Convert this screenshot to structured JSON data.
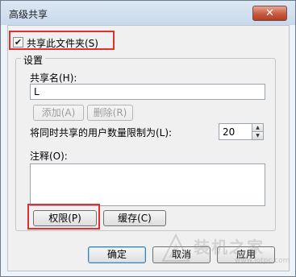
{
  "window": {
    "title": "高级共享",
    "close_symbol": "✕"
  },
  "share_checkbox": {
    "label": "共享此文件夹(S)",
    "checked": true,
    "check_mark": "✔"
  },
  "settings": {
    "group_label": "设置",
    "share_name_label": "共享名(H):",
    "share_name_value": "L",
    "add_button": "添加(A)",
    "remove_button": "删除(R)",
    "user_limit_label": "将同时共享的用户数量限制为(L):",
    "user_limit_value": "20",
    "spin_up_symbol": "▲",
    "spin_down_symbol": "▼",
    "comment_label": "注释(O):",
    "comment_value": "",
    "permissions_button": "权限(P)",
    "caching_button": "缓存(C)"
  },
  "footer": {
    "ok_button": "确定",
    "cancel_button": "取消",
    "apply_button": "应用"
  },
  "watermark": {
    "text": "装机之家",
    "url": "www.lotpc.com"
  },
  "colors": {
    "highlight": "#e03030",
    "title_bar": "#c9d9ec",
    "close_button": "#c75a3f"
  }
}
